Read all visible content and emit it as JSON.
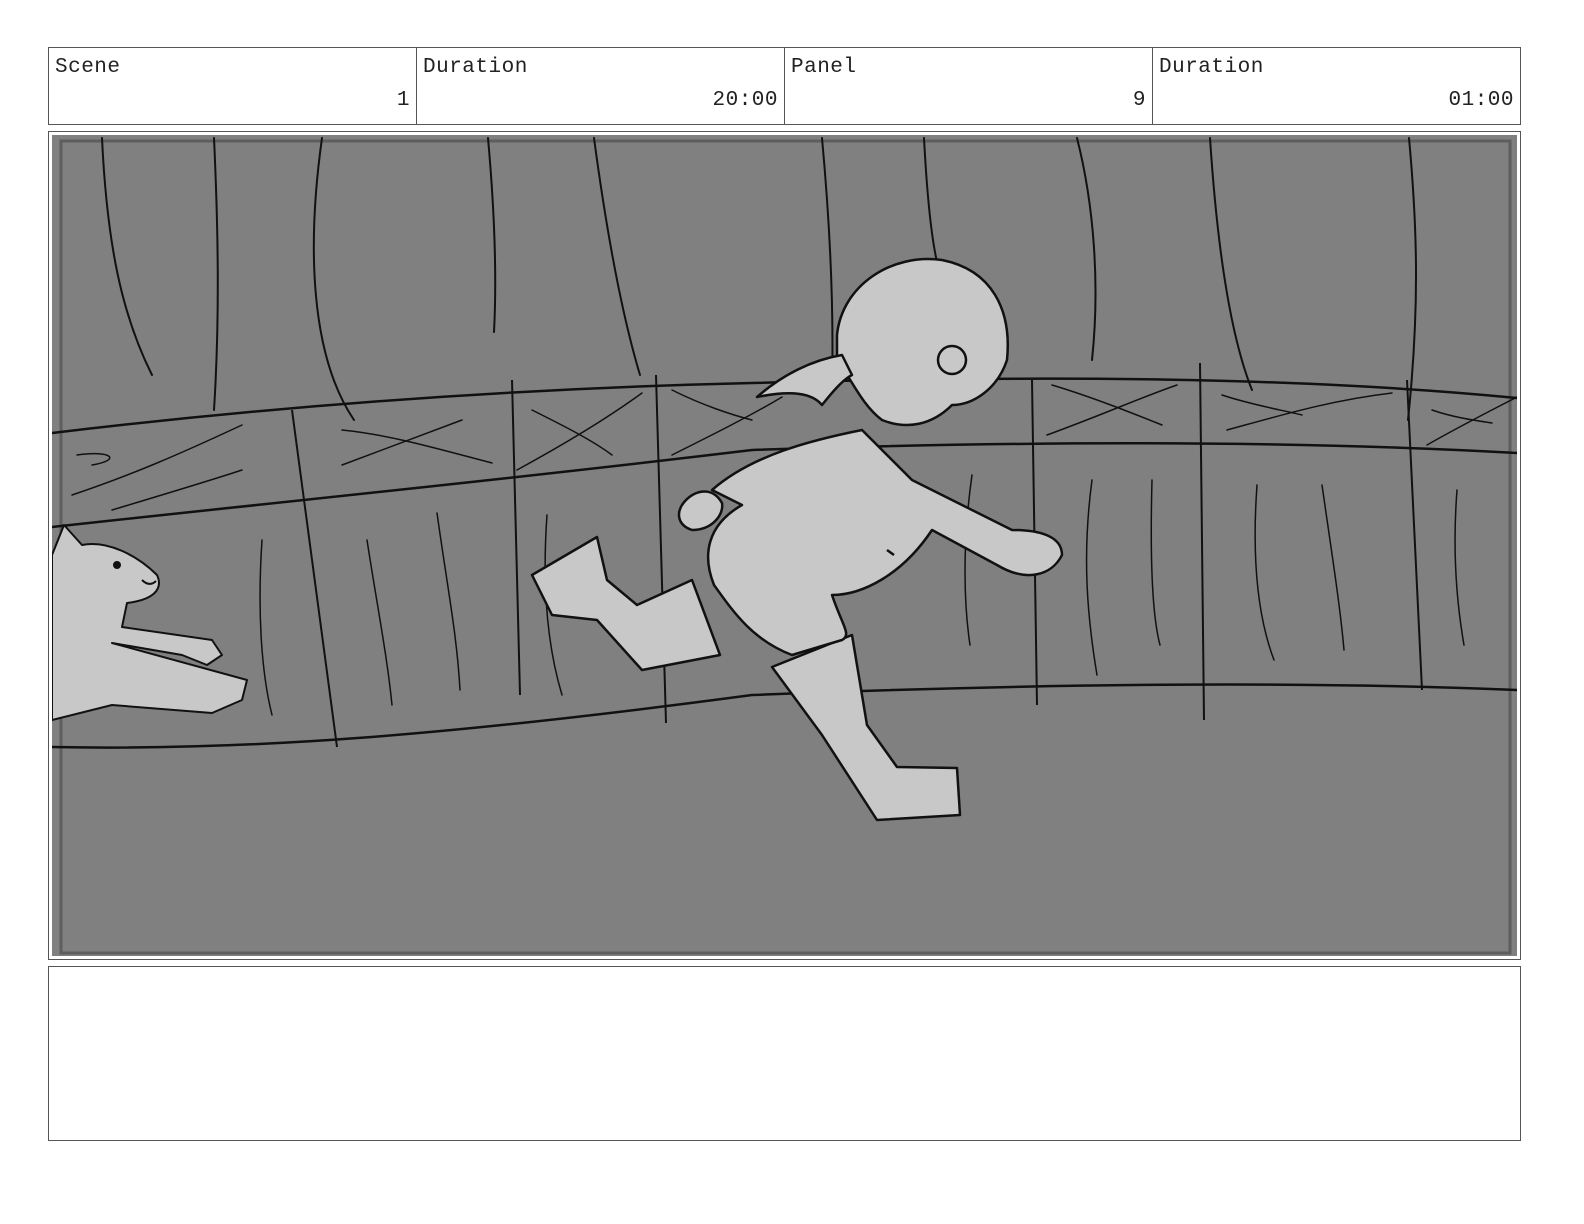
{
  "header": {
    "scene_label": "Scene",
    "scene_value": "1",
    "scene_duration_label": "Duration",
    "scene_duration_value": "20:00",
    "panel_label": "Panel",
    "panel_value": "9",
    "panel_duration_label": "Duration",
    "panel_duration_value": "01:00"
  },
  "panel": {
    "background_color": "#808080",
    "fill_color": "#c8c8c8",
    "line_color": "#111111"
  },
  "notes": {
    "text": ""
  }
}
